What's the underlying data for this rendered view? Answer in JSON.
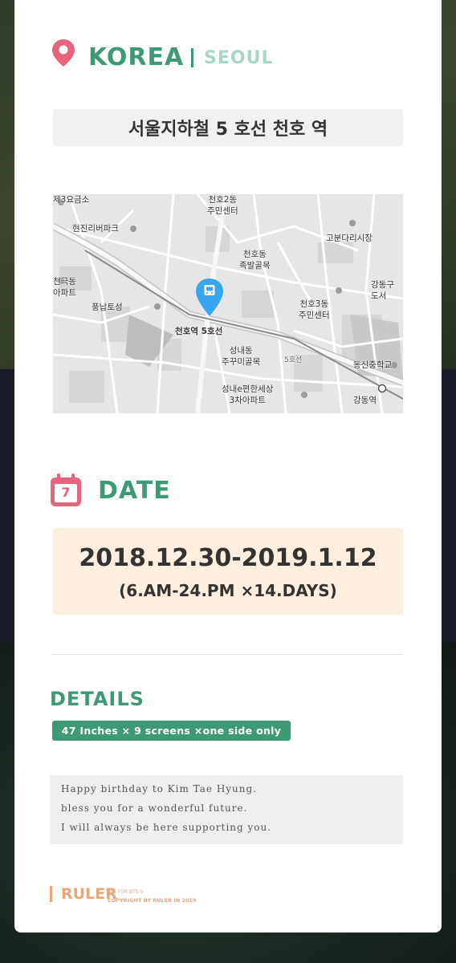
{
  "location": {
    "country": "KOREA",
    "city": "SEOUL",
    "station": "서울지하철 5 호선 천호 역"
  },
  "map": {
    "labels": [
      "제3요금소",
      "천호2동\n주민센터",
      "현진리버파크",
      "고분다리시장",
      "천호동\n족발골목",
      "천극동\n아파트",
      "강동구\n도서",
      "천호3동\n주민센터",
      "풍납토성",
      "천호역 5호선",
      "성내동\n주꾸미골목",
      "5호선",
      "동신중학교",
      "성내e편한세상\n3차아파트",
      "강동역"
    ]
  },
  "date": {
    "heading": "DATE",
    "calendar_day": "7",
    "range": "2018.12.30-2019.1.12",
    "hours": "(6.AM-24.PM ×14.DAYS)"
  },
  "details": {
    "heading": "DETAILS",
    "badge": "47 Inches × 9 screens ×one side only"
  },
  "message": {
    "lines": [
      "Happy birthday to Kim Tae Hyung.",
      "bless you for a wonderful future.",
      "I will always be here supporting you."
    ]
  },
  "footer": {
    "brand": "RULER",
    "small": "ALL FOR BTS V",
    "copyright": "COPYRIGHT BY RULER IN 2019"
  },
  "colors": {
    "accent_green": "#3e9a74",
    "pin_pink": "#e8647e",
    "date_box": "#fcefe0",
    "footer_orange": "#e9a679"
  }
}
